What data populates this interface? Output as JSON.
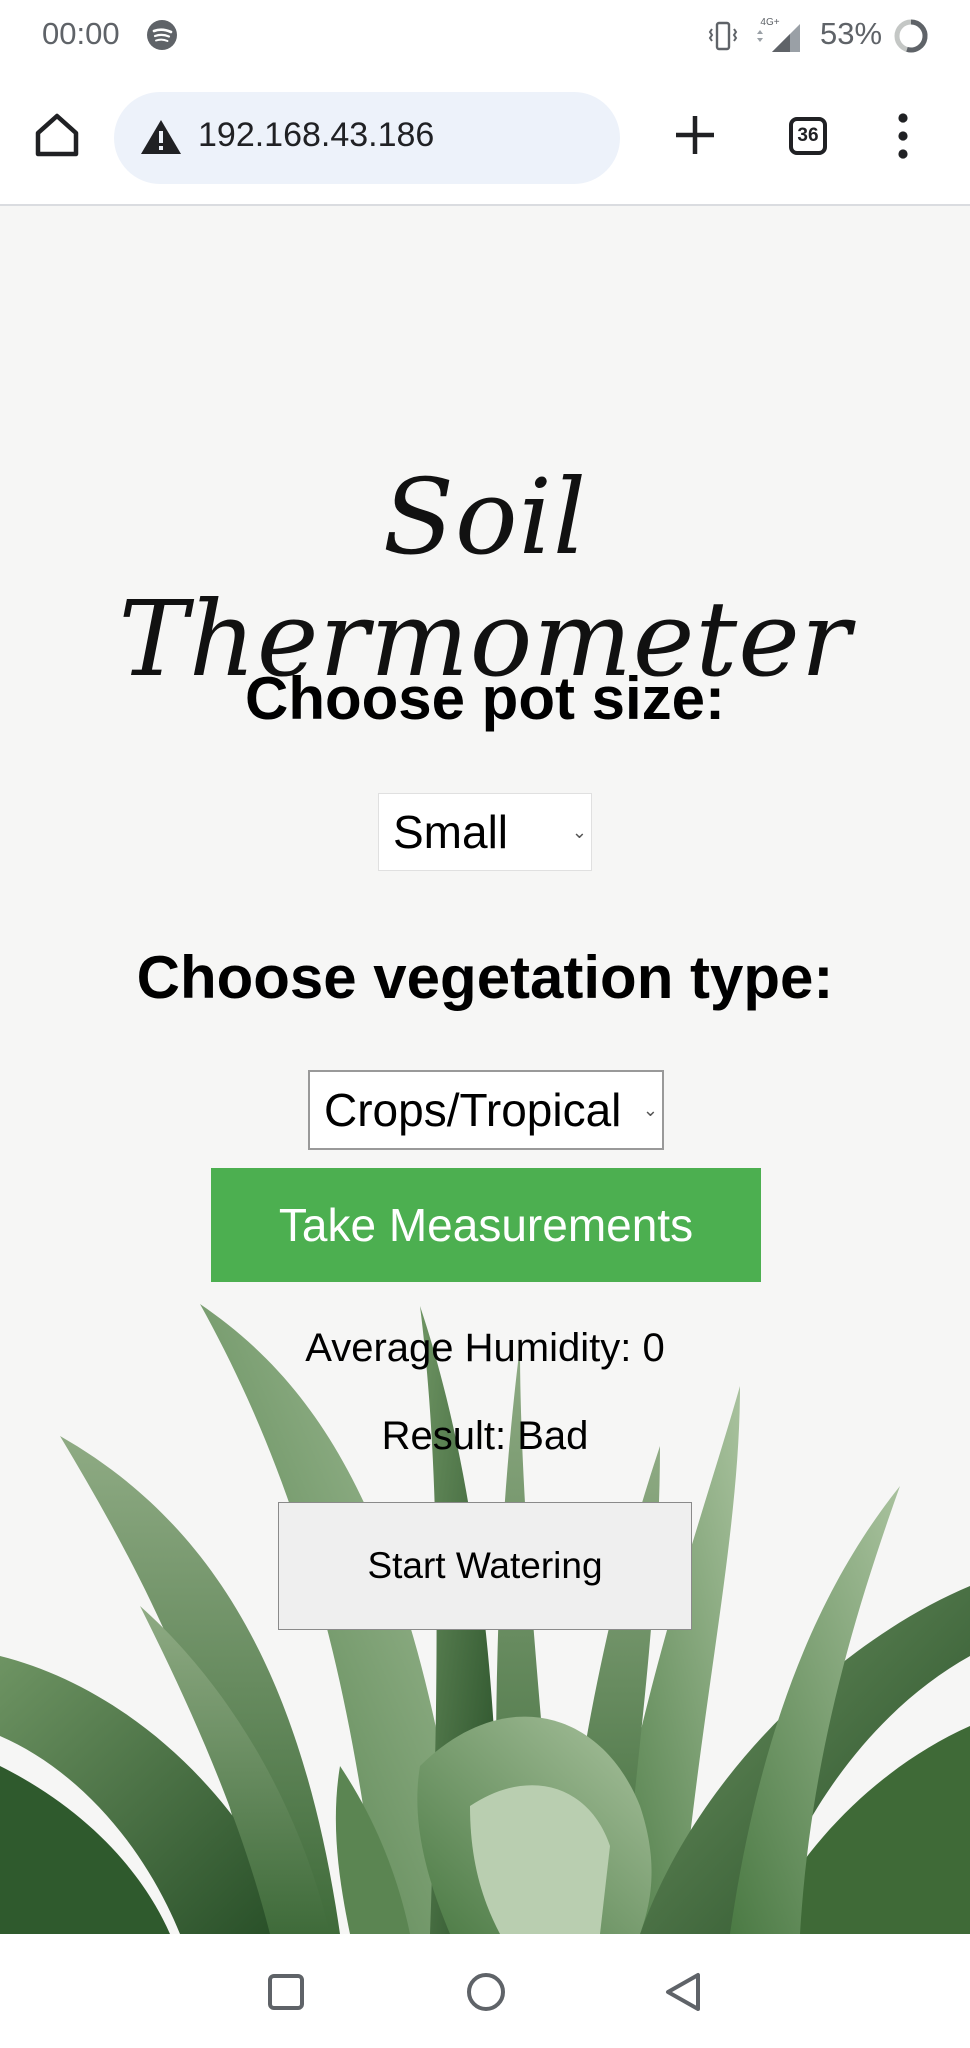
{
  "status_bar": {
    "time": "00:00",
    "battery_percent": "53%",
    "network_label": "4G+",
    "icons": [
      "spotify-icon",
      "vibrate-icon",
      "signal-icon",
      "battery-icon"
    ]
  },
  "browser": {
    "url": "192.168.43.186",
    "tab_count": "36",
    "omnibox_color": "#edf2fa",
    "icons": [
      "home-icon",
      "not-secure-warning-icon",
      "plus-icon",
      "tab-switcher-icon",
      "more-vert-icon"
    ]
  },
  "page": {
    "title": "Soil Thermometer",
    "pot_heading": "Choose pot size:",
    "pot_selected": "Small",
    "veg_heading": "Choose vegetation type:",
    "veg_selected": "Crops/Tropical",
    "take_button": "Take Measurements",
    "take_button_color": "#4caf50",
    "humidity": "Average Humidity: 0",
    "result": "Result: Bad",
    "water_button": "Start Watering"
  },
  "nav_bar": {
    "icons": [
      "recents-icon",
      "home-circle-icon",
      "back-icon"
    ]
  }
}
